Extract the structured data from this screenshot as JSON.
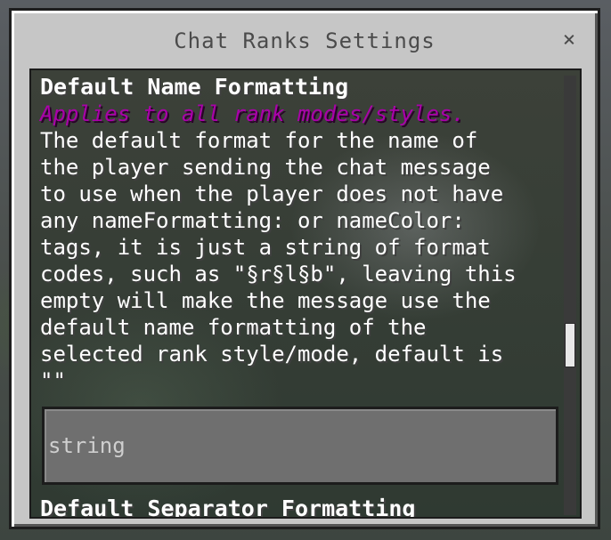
{
  "window": {
    "title": "Chat Ranks Settings",
    "close_glyph": "×"
  },
  "setting_1": {
    "heading": "Default Name Formatting",
    "note": "Applies to all rank modes/styles.",
    "description_lines": [
      "The default format for the name of",
      "the player sending the chat message",
      "to use when the player does not have",
      "any nameFormatting: or nameColor:",
      "tags, it is just a string of format",
      "codes, such as \"§r§l§b\", leaving this",
      "empty will make the message use the",
      "default name formatting of the",
      "selected rank style/mode, default is",
      "\"\""
    ],
    "input_value": "",
    "input_placeholder": "string"
  },
  "setting_2": {
    "heading": "Default Separator Formatting"
  },
  "colors": {
    "note_color": "#aa00aa",
    "text_color": "#ffffff",
    "dialog_bg": "#c6c6c6"
  },
  "icons": {
    "close": "close-icon"
  },
  "scrollbar": {
    "position_fraction": 0.57
  }
}
